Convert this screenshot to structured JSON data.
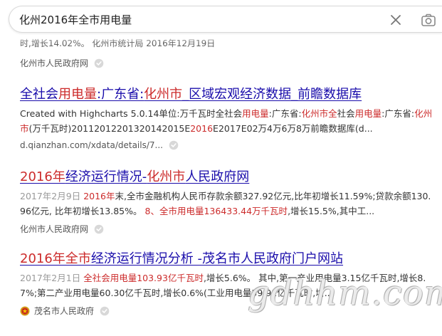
{
  "search": {
    "query": "化州2016年全市用电量"
  },
  "partial_result": {
    "snippet": "时,增长14.02%。 化州市统计局 2016年12月19日",
    "source": "化州市人民政府网"
  },
  "results": [
    {
      "title_parts": [
        "全社会",
        "用电量",
        ":广东省:",
        "化州市",
        "_区域宏观经济数据_前瞻数据库"
      ],
      "snippet_parts": [
        "Created with Highcharts 5.0.14单位:万千瓦时全社会",
        "用电量",
        ":广东省:",
        "化州市全",
        "社会",
        "用电量",
        ":广东省:",
        "化州市",
        "(万千瓦时)20112012201320142015E",
        "2016",
        "E2017E02万4万6万8万前瞻数据库(d..."
      ],
      "source": "d.qianzhan.com/xdata/details/7..."
    },
    {
      "title_parts": [
        "2016年",
        "经济运行情况-",
        "化州市",
        "人民政府网"
      ],
      "date": "2017年2月9日",
      "snippet_parts": [
        "2016年",
        "末,全市金融机构人民币存款余额327.92亿元,比年初增长11.59%;贷款余额130.96亿元, 比年初增长13.85%。 ",
        "8、全市用电量136433.44万千瓦时",
        ",增长15.5%,其中工..."
      ],
      "source": "化州市人民政府网"
    },
    {
      "title_parts": [
        "2016年全市",
        "经济运行情况分析 -茂名市人民政府门户网站"
      ],
      "date": "2017年2月1日",
      "snippet_parts": [
        "全社会用电量103.93亿千瓦时",
        ",增长5.6%。 其中,第一产业用电量3.15亿千瓦时,增长8.7%;第二产业用电量60.30亿千瓦时,增长0.6%(工业用电量59.91亿千瓦时,增..."
      ],
      "source": "茂名市人民政府"
    }
  ],
  "watermark": "gdhhm.com",
  "colors": {
    "link": "#1a0dab",
    "highlight": "#cc2b2b"
  }
}
